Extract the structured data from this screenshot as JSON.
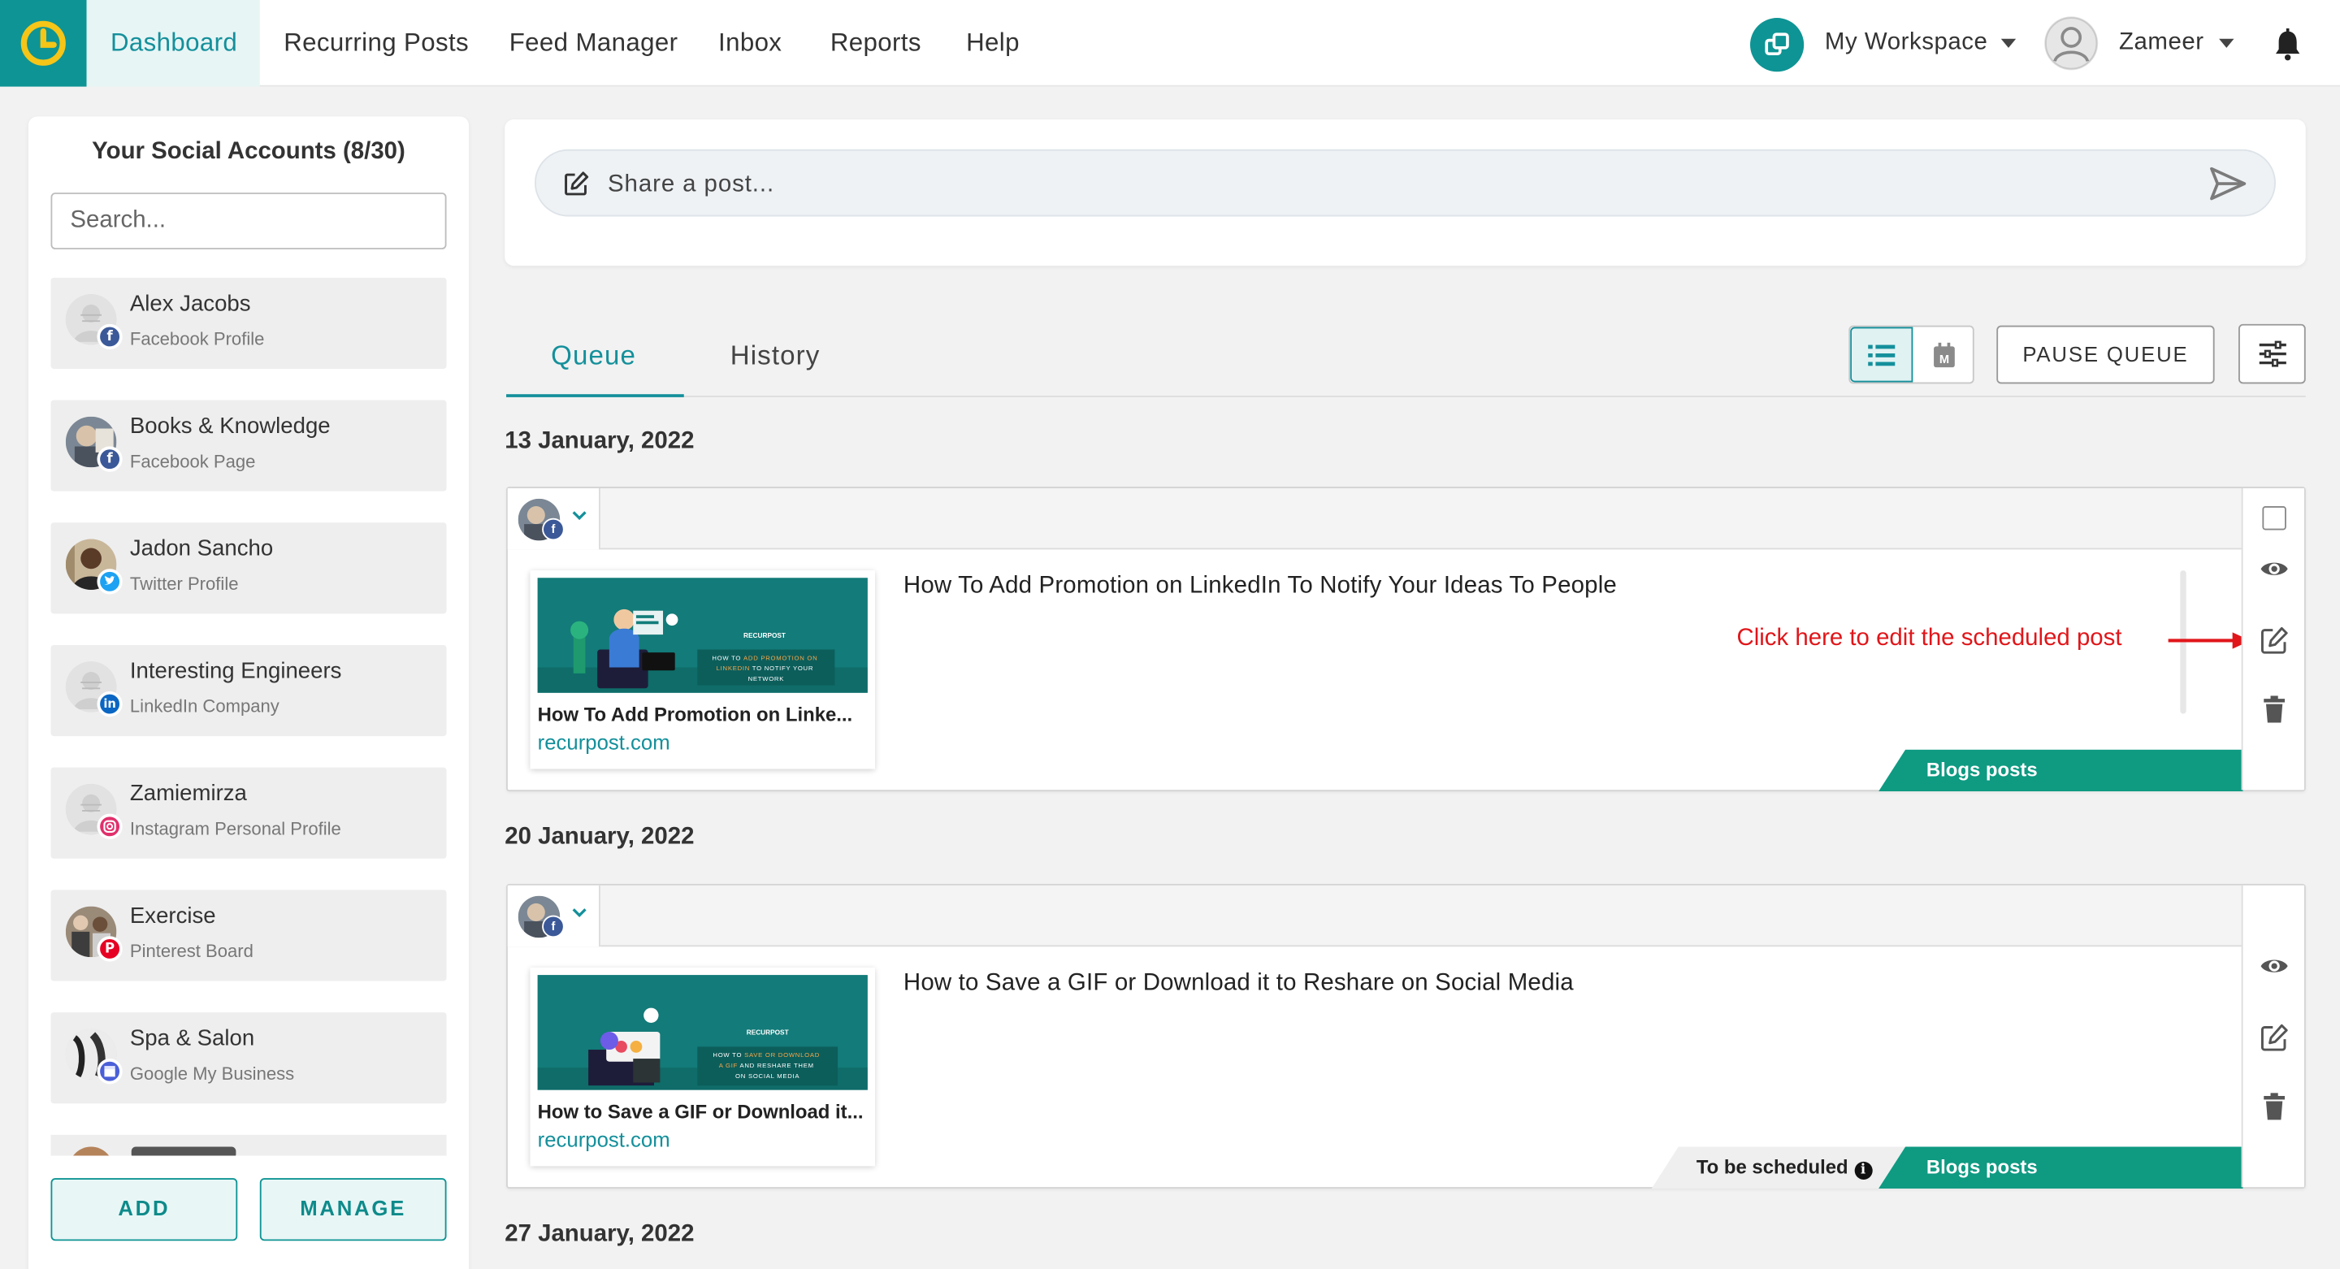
{
  "nav": {
    "items": [
      "Dashboard",
      "Recurring Posts",
      "Feed Manager",
      "Inbox",
      "Reports",
      "Help"
    ],
    "active": "Dashboard",
    "workspace_label": "My Workspace",
    "user_name": "Zameer"
  },
  "sidebar": {
    "title": "Your Social Accounts (8/30)",
    "search_placeholder": "Search...",
    "accounts": [
      {
        "name": "Alex Jacobs",
        "type": "Facebook Profile",
        "network": "facebook"
      },
      {
        "name": "Books & Knowledge",
        "type": "Facebook Page",
        "network": "facebook"
      },
      {
        "name": "Jadon Sancho",
        "type": "Twitter Profile",
        "network": "twitter"
      },
      {
        "name": "Interesting Engineers",
        "type": "LinkedIn Company",
        "network": "linkedin"
      },
      {
        "name": "Zamiemirza",
        "type": "Instagram Personal Profile",
        "network": "instagram"
      },
      {
        "name": "Exercise",
        "type": "Pinterest Board",
        "network": "pinterest"
      },
      {
        "name": "Spa & Salon",
        "type": "Google My Business",
        "network": "google-my-business"
      }
    ],
    "add_label": "ADD",
    "manage_label": "MANAGE"
  },
  "composer": {
    "placeholder": "Share a post..."
  },
  "tabs": {
    "queue": "Queue",
    "history": "History",
    "active": "Queue"
  },
  "toolbar": {
    "pause_label": "PAUSE QUEUE"
  },
  "queue": [
    {
      "date": "13 January, 2022",
      "post": {
        "text": "How To Add Promotion on LinkedIn To Notify Your Ideas To People",
        "preview_title": "How To Add Promotion on Linke...",
        "preview_domain": "recurpost.com",
        "preview_image_brand": "RECURPOST",
        "preview_image_caption": "HOW TO ADD PROMOTION ON LINKEDIN TO NOTIFY YOUR NETWORK",
        "category": "Blogs posts",
        "annotation": "Click here to edit the scheduled post"
      }
    },
    {
      "date": "20 January, 2022",
      "post": {
        "text": "How to Save a GIF or Download it to Reshare on Social Media",
        "preview_title": "How to Save a GIF or Download it...",
        "preview_domain": "recurpost.com",
        "preview_image_brand": "RECURPOST",
        "preview_image_caption": "HOW TO SAVE OR DOWNLOAD A GIF AND RESHARE THEM ON SOCIAL MEDIA",
        "status": "To be scheduled",
        "category": "Blogs posts"
      }
    },
    {
      "date": "27 January, 2022"
    }
  ],
  "colors": {
    "brand": "#0e9494",
    "category_tag": "#0f9a82",
    "annotation": "#e0161a",
    "facebook": "#3b5998",
    "twitter": "#1da1f2",
    "linkedin": "#0a66c2",
    "instagram": "#e1306c",
    "pinterest": "#e60023",
    "google_my_business": "#4a5fd8"
  }
}
